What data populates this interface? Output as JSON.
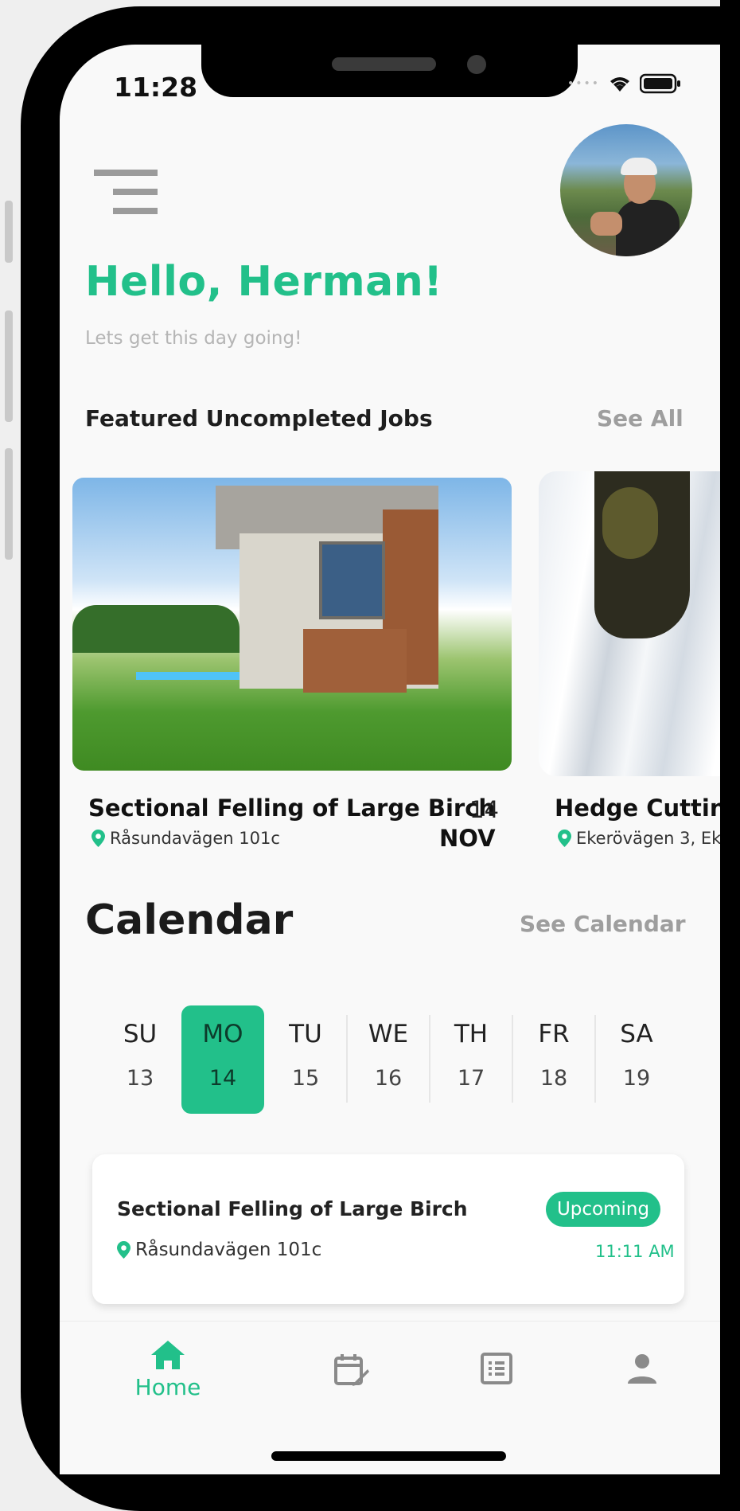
{
  "status_bar": {
    "time": "11:28",
    "icons": [
      "signal-dots-icon",
      "wifi-icon",
      "battery-icon"
    ]
  },
  "header": {
    "menu_icon": "hamburger-menu-icon",
    "greeting": "Hello, Herman!",
    "subtitle": "Lets get this day going!"
  },
  "featured": {
    "title": "Featured Uncompleted Jobs",
    "see_all": "See All",
    "jobs": [
      {
        "title": "Sectional Felling of Large Birch",
        "location": "Råsundavägen 101c",
        "day": "14",
        "month": "NOV"
      },
      {
        "title": "Hedge Cutting",
        "location": "Ekerövägen 3, Ek"
      }
    ]
  },
  "calendar": {
    "title": "Calendar",
    "see_calendar": "See Calendar",
    "days": [
      {
        "name": "SU",
        "date": "13"
      },
      {
        "name": "MO",
        "date": "14",
        "selected": true
      },
      {
        "name": "TU",
        "date": "15"
      },
      {
        "name": "WE",
        "date": "16"
      },
      {
        "name": "TH",
        "date": "17"
      },
      {
        "name": "FR",
        "date": "18"
      },
      {
        "name": "SA",
        "date": "19"
      }
    ],
    "event": {
      "title": "Sectional Felling of Large Birch",
      "location": "Råsundavägen 101c",
      "status": "Upcoming",
      "time": "11:11 AM"
    }
  },
  "tabbar": {
    "tabs": [
      {
        "icon": "home-icon",
        "label": "Home",
        "active": true
      },
      {
        "icon": "calendar-edit-icon"
      },
      {
        "icon": "list-icon"
      },
      {
        "icon": "person-icon"
      }
    ]
  },
  "colors": {
    "accent": "#22c08a",
    "muted": "#9e9e9e",
    "background": "#f9f9f9"
  }
}
